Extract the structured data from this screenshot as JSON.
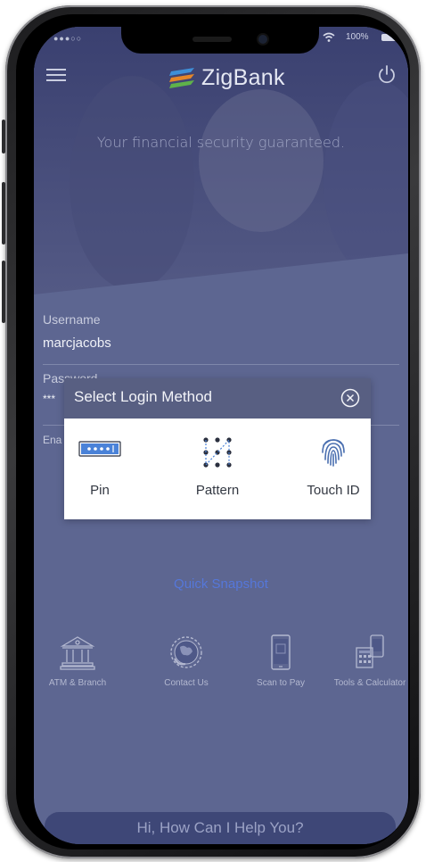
{
  "status_bar": {
    "signal": "●●●○○",
    "battery": "100%"
  },
  "header": {
    "app_name": "ZigBank"
  },
  "hero": {
    "tagline": "Your financial security guaranteed."
  },
  "login_form": {
    "username_label": "Username",
    "username_value": "marcjacobs",
    "password_label": "Password",
    "password_value": "***",
    "enable_label": "Ena"
  },
  "login_method_modal": {
    "title": "Select Login Method",
    "options": [
      {
        "label": "Pin",
        "icon": "pin-icon"
      },
      {
        "label": "Pattern",
        "icon": "pattern-icon"
      },
      {
        "label": "Touch ID",
        "icon": "fingerprint-icon"
      }
    ]
  },
  "quick_snapshot": {
    "label": "Quick Snapshot"
  },
  "quick_links": [
    {
      "label": "ATM & Branch",
      "icon": "bank-icon"
    },
    {
      "label": "Contact Us",
      "icon": "contact-globe-icon"
    },
    {
      "label": "Scan to Pay",
      "icon": "phone-scan-icon"
    },
    {
      "label": "Tools & Calculator",
      "icon": "calculator-icon"
    }
  ],
  "chatbot": {
    "prompt": "Hi, How Can I Help You?"
  },
  "colors": {
    "screen_bg": "#5d6691",
    "modal_header": "#585f82",
    "accent_link": "#5577da"
  }
}
